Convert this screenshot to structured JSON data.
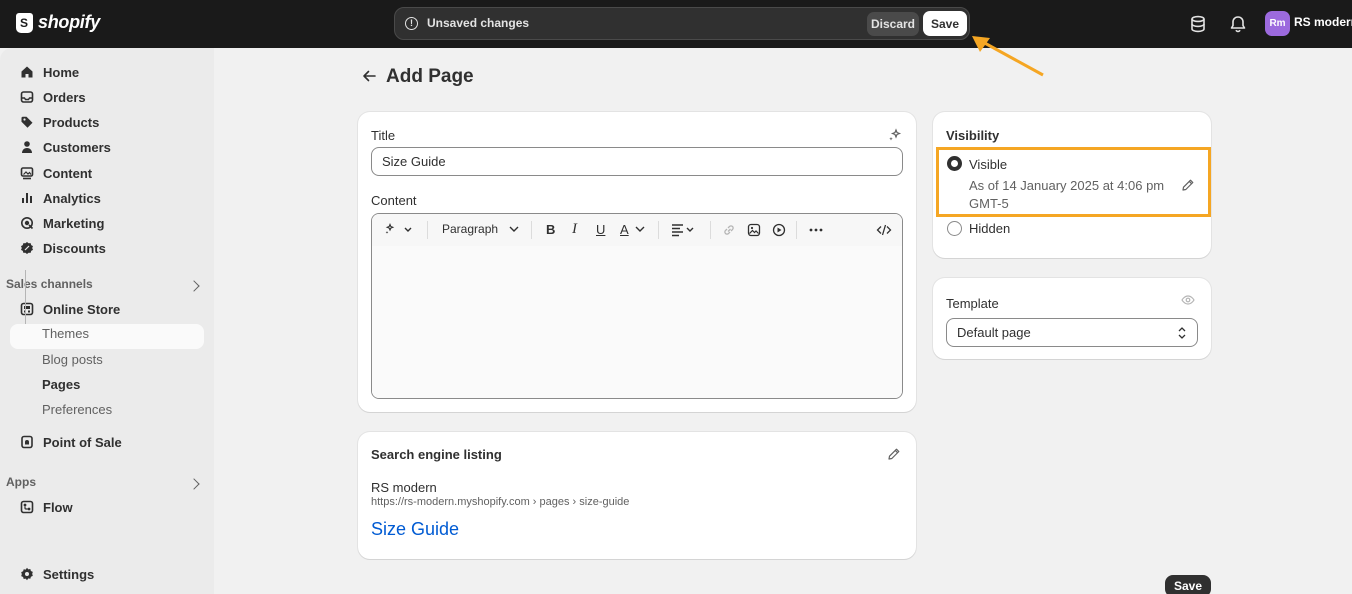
{
  "brand": {
    "name": "shopify"
  },
  "unsaved": {
    "message": "Unsaved changes",
    "discard_label": "Discard",
    "save_label": "Save"
  },
  "account": {
    "initials": "Rm",
    "store_name": "RS modern"
  },
  "sidebar": {
    "items": [
      {
        "label": "Home",
        "icon": "home-icon"
      },
      {
        "label": "Orders",
        "icon": "inbox-icon"
      },
      {
        "label": "Products",
        "icon": "tag-icon"
      },
      {
        "label": "Customers",
        "icon": "person-icon"
      },
      {
        "label": "Content",
        "icon": "image-icon"
      },
      {
        "label": "Analytics",
        "icon": "bar-chart-icon"
      },
      {
        "label": "Marketing",
        "icon": "target-icon"
      },
      {
        "label": "Discounts",
        "icon": "discount-icon"
      }
    ],
    "sales_channels_label": "Sales channels",
    "online_store": "Online Store",
    "sub_items": [
      "Themes",
      "Blog posts",
      "Pages",
      "Preferences"
    ],
    "point_of_sale": "Point of Sale",
    "apps_label": "Apps",
    "flow": "Flow",
    "settings": "Settings"
  },
  "page": {
    "title": "Add Page"
  },
  "form": {
    "title_label": "Title",
    "title_value": "Size Guide",
    "content_label": "Content",
    "toolbar": {
      "paragraph": "Paragraph"
    }
  },
  "seo": {
    "heading": "Search engine listing",
    "store": "RS modern",
    "url": "https://rs-modern.myshopify.com › pages › size-guide",
    "title": "Size Guide"
  },
  "visibility": {
    "heading": "Visibility",
    "visible_label": "Visible",
    "visible_line1": "As of 14 January 2025 at 4:06 pm",
    "visible_line2": "GMT-5",
    "hidden_label": "Hidden"
  },
  "template": {
    "heading": "Template",
    "selected": "Default page"
  },
  "footer": {
    "save_label": "Save"
  },
  "colors": {
    "highlight": "#f5a623",
    "link": "#005bd3",
    "avatar": "#9c6ade"
  }
}
